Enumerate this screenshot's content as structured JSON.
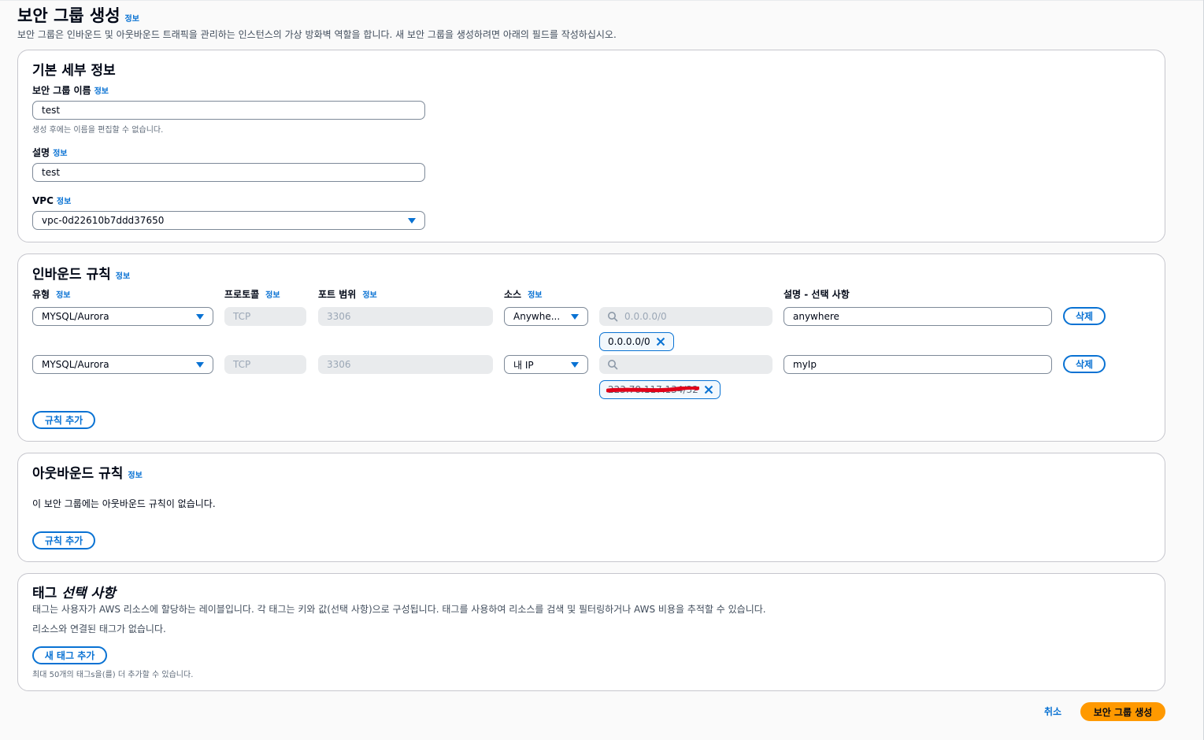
{
  "page": {
    "title": "보안 그룹 생성",
    "info": "정보",
    "description": "보안 그룹은 인바운드 및 아웃바운드 트래픽을 관리하는 인스턴스의 가상 방화벽 역할을 합니다. 새 보안 그룹을 생성하려면 아래의 필드를 작성하십시오."
  },
  "basic": {
    "title": "기본 세부 정보",
    "name_label": "보안 그룹 이름",
    "name_value": "test",
    "name_hint": "생성 후에는 이름을 편집할 수 없습니다.",
    "desc_label": "설명",
    "desc_value": "test",
    "vpc_label": "VPC",
    "vpc_value": "vpc-0d22610b7ddd37650"
  },
  "inbound": {
    "title": "인바운드 규칙",
    "columns": {
      "type": "유형",
      "protocol": "프로토콜",
      "port": "포트 범위",
      "source": "소스",
      "description": "설명 - 선택 사항"
    },
    "rows": [
      {
        "type": "MYSQL/Aurora",
        "protocol": "TCP",
        "port": "3306",
        "source": "Anywhe...",
        "search_placeholder": "0.0.0.0/0",
        "token": "0.0.0.0/0",
        "description": "anywhere",
        "delete": "삭제"
      },
      {
        "type": "MYSQL/Aurora",
        "protocol": "TCP",
        "port": "3306",
        "source": "내 IP",
        "search_placeholder": "",
        "token": "223.78.117.134/32",
        "description": "myIp",
        "delete": "삭제"
      }
    ],
    "add_rule": "규칙 추가"
  },
  "outbound": {
    "title": "아웃바운드 규칙",
    "empty": "이 보안 그룹에는 아웃바운드 규칙이 없습니다.",
    "add_rule": "규칙 추가"
  },
  "tags": {
    "title": "태그",
    "title_optional": "선택 사항",
    "description": "태그는 사용자가 AWS 리소스에 할당하는 레이블입니다. 각 태그는 키와 값(선택 사항)으로 구성됩니다. 태그를 사용하여 리소스를 검색 및 필터링하거나 AWS 비용을 추적할 수 있습니다.",
    "empty": "리소스와 연결된 태그가 없습니다.",
    "add_tag": "새 태그 추가",
    "limit": "최대 50개의 태그s을(를) 더 추가할 수 있습니다."
  },
  "footer": {
    "cancel": "취소",
    "create": "보안 그룹 생성"
  },
  "colors": {
    "link": "#0972d3",
    "primary": "#ff9900",
    "redaction": "#e0001a"
  }
}
